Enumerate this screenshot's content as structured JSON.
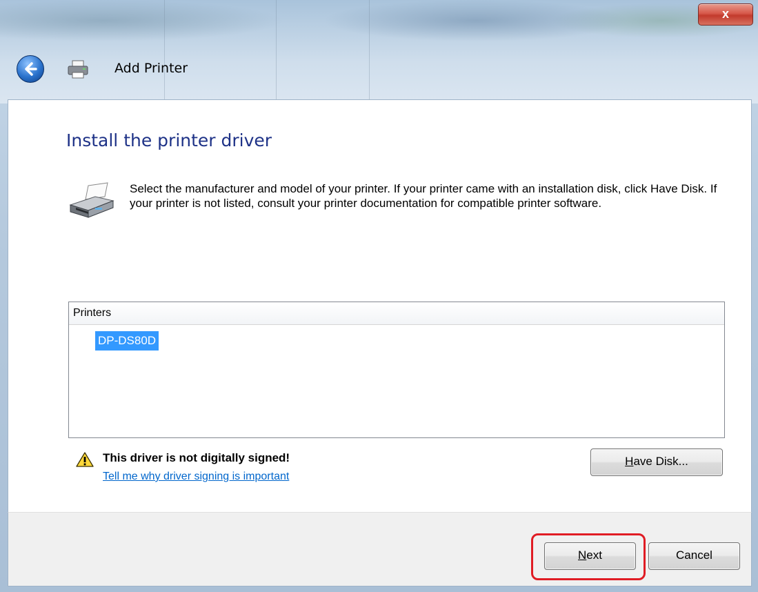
{
  "window": {
    "title": "Add Printer",
    "close_label": "x"
  },
  "content": {
    "heading": "Install the printer driver",
    "description": "Select the manufacturer and model of your printer. If your printer came with an installation disk, click Have Disk. If your printer is not listed, consult your printer documentation for compatible printer software."
  },
  "printers_list": {
    "header": "Printers",
    "items": [
      {
        "label": "DP-DS80D",
        "selected": true
      }
    ]
  },
  "warning": {
    "title": "This driver is not digitally signed!",
    "link": "Tell me why driver signing is important"
  },
  "buttons": {
    "have_disk": {
      "mnemonic": "H",
      "rest": "ave Disk..."
    },
    "next": {
      "mnemonic": "N",
      "rest": "ext"
    },
    "cancel": "Cancel"
  },
  "colors": {
    "heading": "#1e3287",
    "selection": "#3399ff",
    "link": "#0066cc",
    "highlight_border": "#e01c24"
  }
}
